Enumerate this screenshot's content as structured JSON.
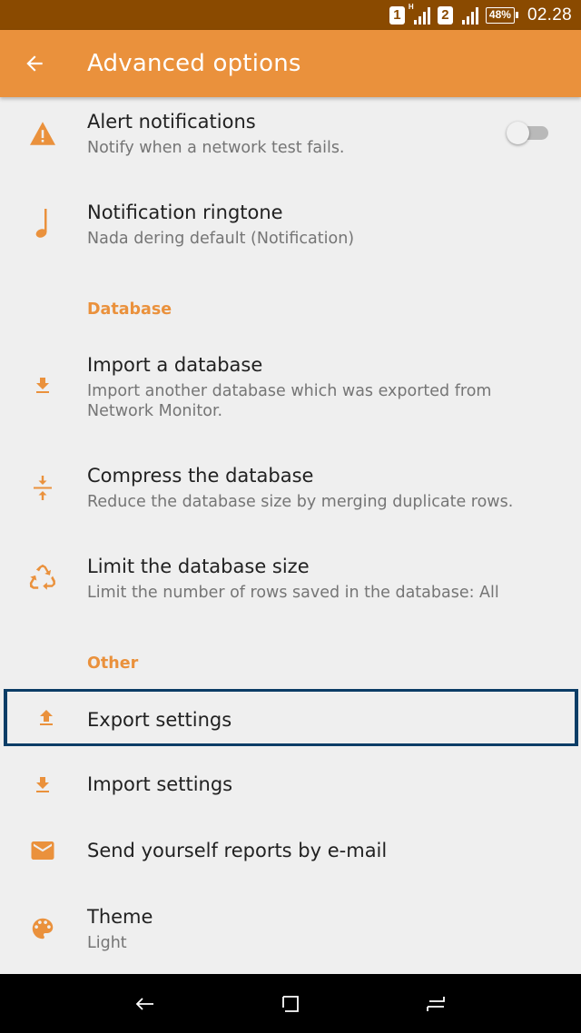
{
  "status_bar": {
    "sim1": "1",
    "sim2": "2",
    "network_type": "H",
    "battery": "48%",
    "time": "02.28"
  },
  "app_bar": {
    "title": "Advanced options",
    "back_icon": "arrow-left-icon"
  },
  "colors": {
    "accent": "#ea913c",
    "status_bar": "#8a4a00",
    "focus_border": "#0b3d66"
  },
  "settings": {
    "alert_notifications": {
      "title": "Alert notifications",
      "summary": "Notify when a network test fails.",
      "icon": "warning-icon",
      "toggle_on": false
    },
    "notification_ringtone": {
      "title": "Notification ringtone",
      "summary": "Nada dering default (Notification)",
      "icon": "music-note-icon"
    },
    "database_header": "Database",
    "import_database": {
      "title": "Import a database",
      "summary": "Import another database which was exported from Network Monitor.",
      "icon": "download-icon"
    },
    "compress_database": {
      "title": "Compress the database",
      "summary": "Reduce the database size by merging duplicate rows.",
      "icon": "compress-icon"
    },
    "limit_database": {
      "title": "Limit the database size",
      "summary": "Limit the number of rows saved in the database: All",
      "icon": "recycle-icon"
    },
    "other_header": "Other",
    "export_settings": {
      "title": "Export settings",
      "icon": "upload-icon",
      "focused": true
    },
    "import_settings": {
      "title": "Import settings",
      "icon": "download-icon"
    },
    "send_reports": {
      "title": "Send yourself reports by e-mail",
      "icon": "email-icon"
    },
    "theme": {
      "title": "Theme",
      "summary": "Light",
      "icon": "palette-icon"
    }
  },
  "nav_bar": {
    "back": "nav-back-icon",
    "home": "nav-home-icon",
    "recents": "nav-recents-icon"
  }
}
